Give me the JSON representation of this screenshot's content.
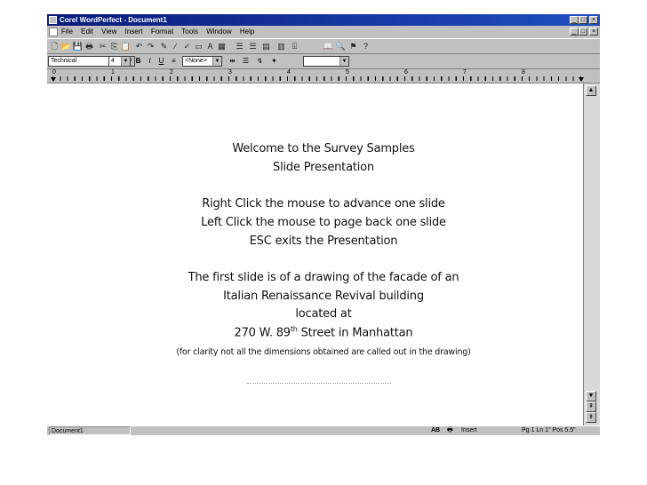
{
  "window": {
    "title": "Corel WordPerfect - Document1",
    "buttons": {
      "minimize": "_",
      "maximize": "□",
      "close": "×"
    }
  },
  "menubar": {
    "items": [
      "File",
      "Edit",
      "View",
      "Insert",
      "Format",
      "Tools",
      "Window",
      "Help"
    ]
  },
  "propbar": {
    "font": "Technical",
    "size": "4",
    "bold": "B",
    "italic": "I",
    "underline": "U",
    "style": "<None>"
  },
  "ruler": {
    "labels": [
      "0",
      "1",
      "2",
      "3",
      "4",
      "5",
      "6",
      "7",
      "8"
    ]
  },
  "slide": {
    "line1": "Welcome to the Survey Samples",
    "line2": "Slide Presentation",
    "line3": "Right Click the mouse  to advance one slide",
    "line4": "Left Click the mouse  to page back one slide",
    "line5": "ESC exits the Presentation",
    "line6": "The first slide is of a drawing of the facade of an",
    "line7": "Italian Renaissance Revival building",
    "line8": "located at",
    "line9_a": "270 W. 89",
    "line9_sup": "th",
    "line9_b": " Street in Manhattan",
    "line10": "(for clarity not all the dimensions obtained are called out in the drawing)"
  },
  "statusbar": {
    "document": "Document1",
    "ab_icon": "AB",
    "mode": "Insert",
    "position": "Pg 1 Ln 1\" Pos 5.5\""
  }
}
